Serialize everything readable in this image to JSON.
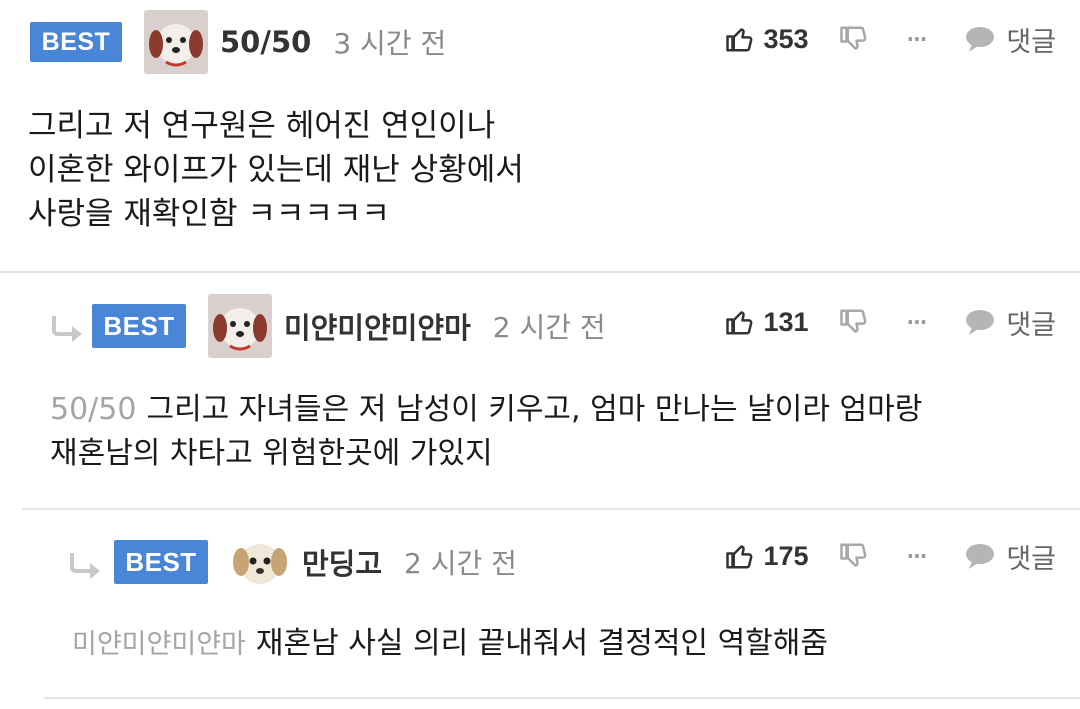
{
  "comments": [
    {
      "badge": "BEST",
      "nickname": "50/50",
      "time": "3 시간 전",
      "likes": "353",
      "reply_label": "댓글",
      "more": "···",
      "lines": [
        "그리고 저 연구원은 헤어진 연인이나",
        "이혼한 와이프가 있는데 재난 상황에서",
        "사랑을 재확인함 ㅋㅋㅋㅋㅋ"
      ]
    },
    {
      "badge": "BEST",
      "nickname": "미얀미얀미얀마",
      "time": "2 시간 전",
      "likes": "131",
      "reply_label": "댓글",
      "more": "···",
      "mention": "50/50",
      "line1": "그리고 자녀들은 저 남성이 키우고, 엄마 만나는 날이라 엄마랑",
      "line2": "재혼남의 차타고 위험한곳에 가있지"
    },
    {
      "badge": "BEST",
      "nickname": "만딩고",
      "time": "2 시간 전",
      "likes": "175",
      "reply_label": "댓글",
      "more": "···",
      "mention": "미얀미얀미얀마",
      "line1": "재혼남 사실 의리 끝내줘서 결정적인 역할해줌"
    }
  ],
  "colors": {
    "badge": "#4a86d8",
    "divider": "#e4e4e4",
    "mention": "#a5a5a5",
    "time": "#8a8a8a"
  },
  "icons": [
    "thumbs-up-icon",
    "thumbs-down-icon",
    "more-icon",
    "speech-bubble-icon",
    "reply-arrow-icon"
  ]
}
